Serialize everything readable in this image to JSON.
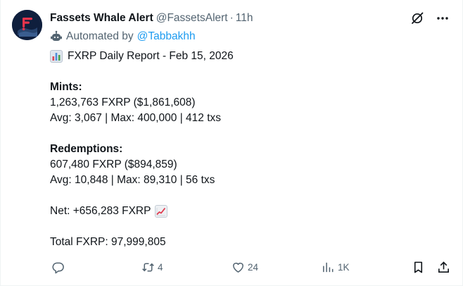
{
  "author": {
    "name": "Fassets Whale Alert",
    "handle": "@FassetsAlert",
    "separator": "·",
    "time": "11h",
    "automated_prefix": "Automated by",
    "automated_link": "@Tabbakhh"
  },
  "post": {
    "title": "FXRP Daily Report - Feb 15, 2026",
    "mints_heading": "Mints:",
    "mints_total": "1,263,763 FXRP ($1,861,608)",
    "mints_stats": "Avg: 3,067 | Max: 400,000 | 412 txs",
    "redemptions_heading": "Redemptions:",
    "redemptions_total": "607,480 FXRP ($894,859)",
    "redemptions_stats": "Avg: 10,848 | Max: 89,310 | 56 txs",
    "net": "Net: +656,283 FXRP",
    "total": "Total FXRP: 97,999,805"
  },
  "actions": {
    "replies": "",
    "reposts": "4",
    "likes": "24",
    "views": "1K"
  },
  "icons": {
    "avatar": "fassets-logo-icon",
    "grok": "grok-icon",
    "more": "more-horizontal-icon",
    "bot": "bot-icon",
    "title_emoji": "bar-chart-emoji-icon",
    "net_emoji": "chart-increasing-emoji-icon",
    "reply": "reply-icon",
    "repost": "repost-icon",
    "like": "heart-icon",
    "views": "views-icon",
    "bookmark": "bookmark-icon",
    "share": "share-icon"
  },
  "colors": {
    "text": "#0f1419",
    "secondary": "#536471",
    "link": "#1d9bf0",
    "avatar_bg": "#0f1f3d",
    "logo_red": "#e8344c"
  }
}
